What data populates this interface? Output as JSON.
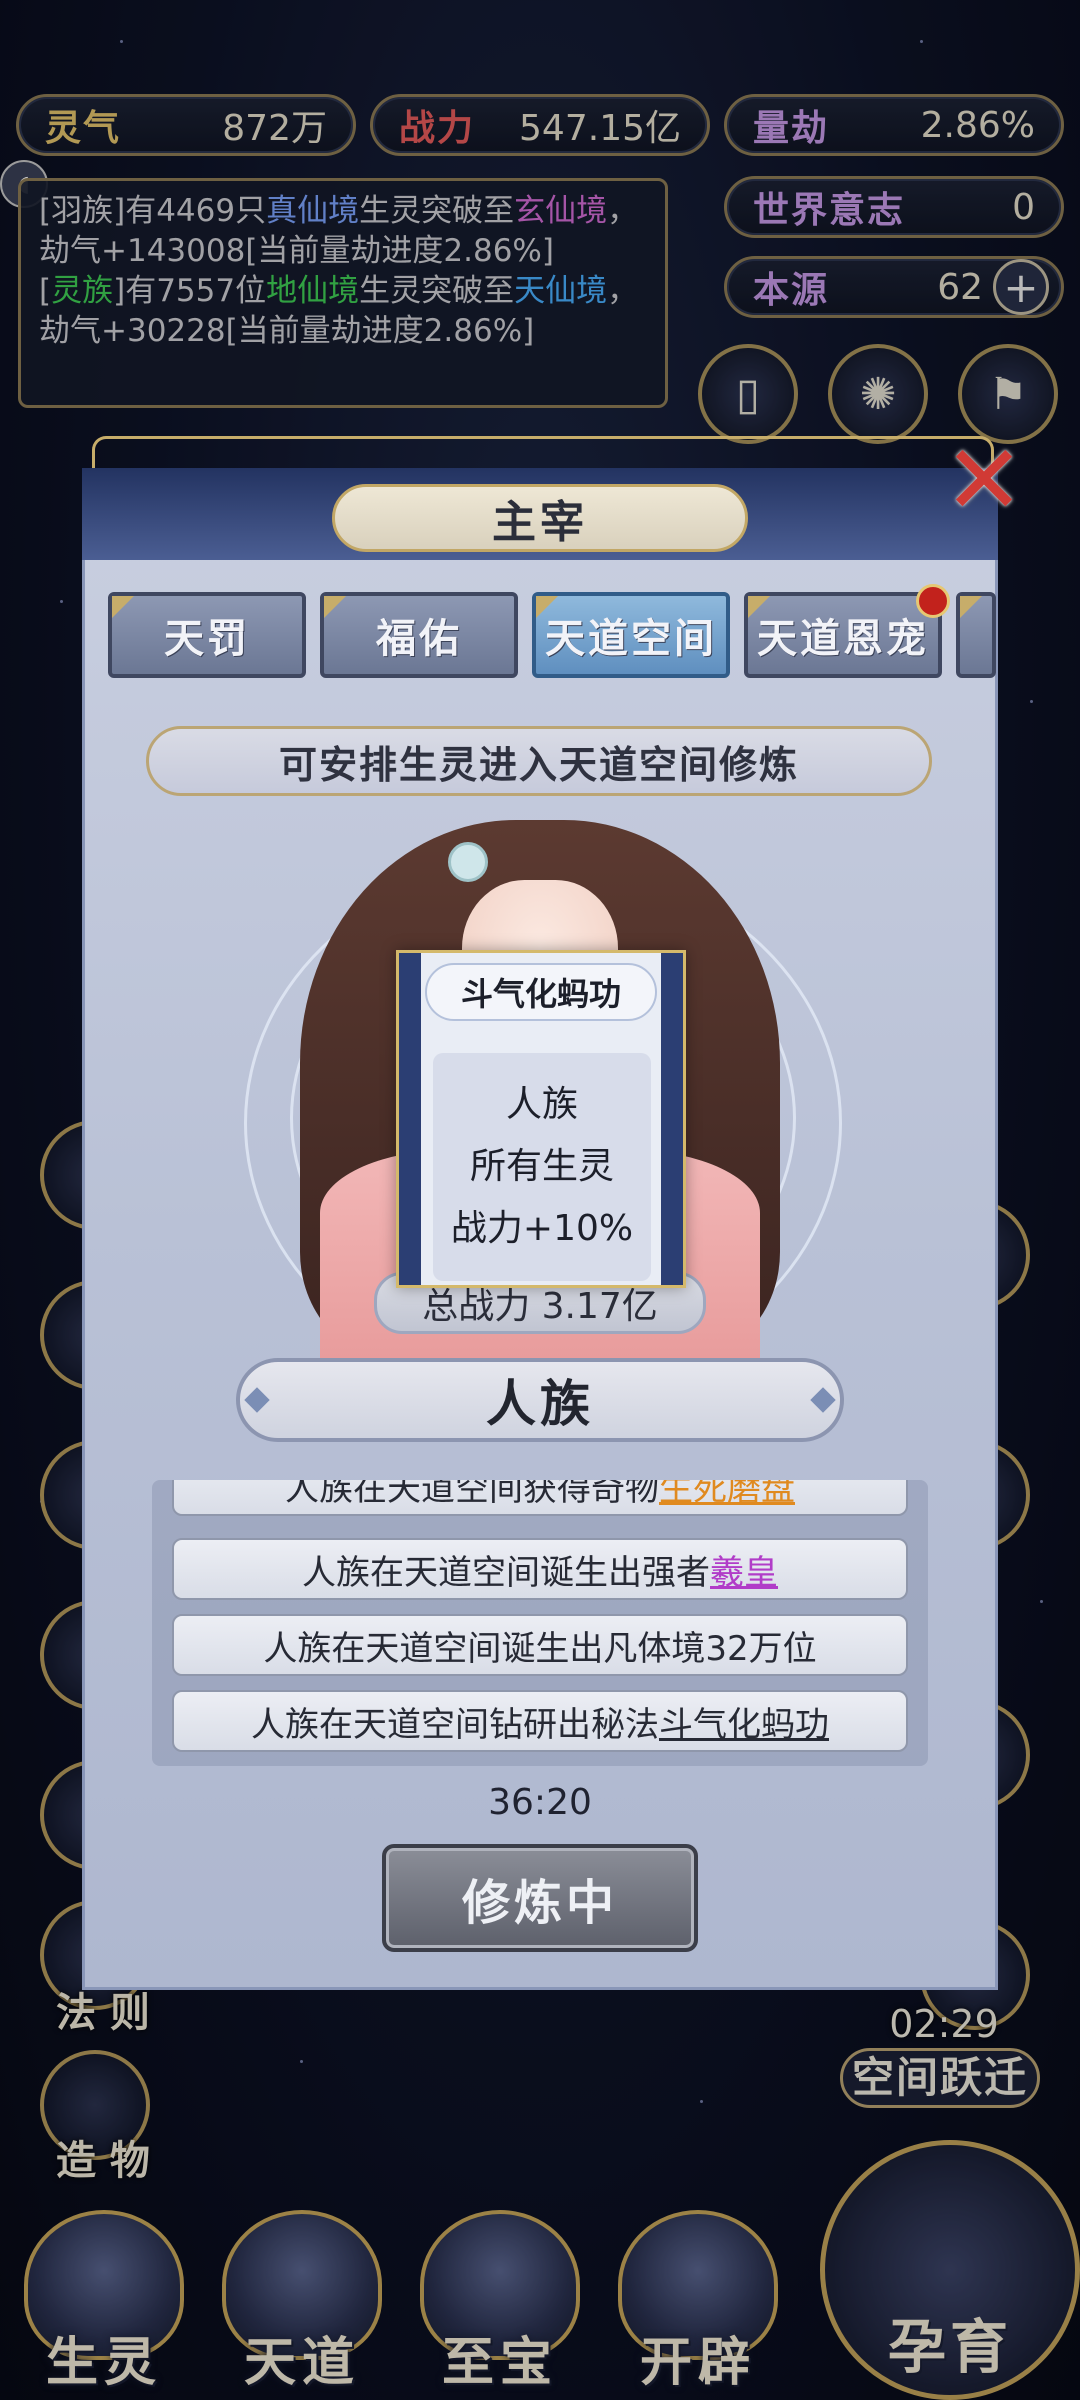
{
  "resources": {
    "lingqi_label": "灵气",
    "lingqi_value": "872万",
    "zhanli_label": "战力",
    "zhanli_value": "547.15亿",
    "liangjie_label": "量劫",
    "liangjie_value": "2.86%",
    "shijie_label": "世界意志",
    "shijie_value": "0",
    "benyuan_label": "本源",
    "benyuan_value": "62"
  },
  "log": {
    "line1": {
      "p1": "[羽族]有4469只",
      "p2": "真仙境",
      "p3": "生灵突破至",
      "p4": "玄仙境",
      "p5": "，劫气+143008[当前量劫进度2.86%]"
    },
    "line2": {
      "p1": "[",
      "p2": "灵族",
      "p3": "]有7557位",
      "p4": "地仙境",
      "p5": "生灵突破至",
      "p6": "天仙境",
      "p7": "，劫气+30228[当前量劫进度2.86%]"
    }
  },
  "dialog": {
    "title": "主宰",
    "tabs": [
      "天罚",
      "福佑",
      "天道空间",
      "天道恩宠"
    ],
    "info": "可安排生灵进入天道空间修炼",
    "total_power": "总战力 3.17亿",
    "race": "人族",
    "events": [
      {
        "p1": "人族在天道空间获得奇物",
        "p2": "生死磨盘"
      },
      {
        "p1": "人族在天道空间诞生出强者",
        "p2": "羲皇"
      },
      {
        "p1": "人族在天道空间诞生出凡体境32万位",
        "p2": ""
      },
      {
        "p1": "人族在天道空间钻研出秘法",
        "p2": "斗气化蚂功"
      }
    ],
    "timer": "36:20",
    "train_button": "修炼中"
  },
  "popup": {
    "title": "斗气化蚂功",
    "line1": "人族",
    "line2": "所有生灵",
    "line3": "战力+10%"
  },
  "side": {
    "left_labels": [
      "法 则",
      "造 物"
    ],
    "right_time": "02:29",
    "right_leap": "空间跃迁"
  },
  "nav": {
    "items": [
      "生灵",
      "天道",
      "至宝",
      "开辟"
    ],
    "nurture": "孕育"
  }
}
